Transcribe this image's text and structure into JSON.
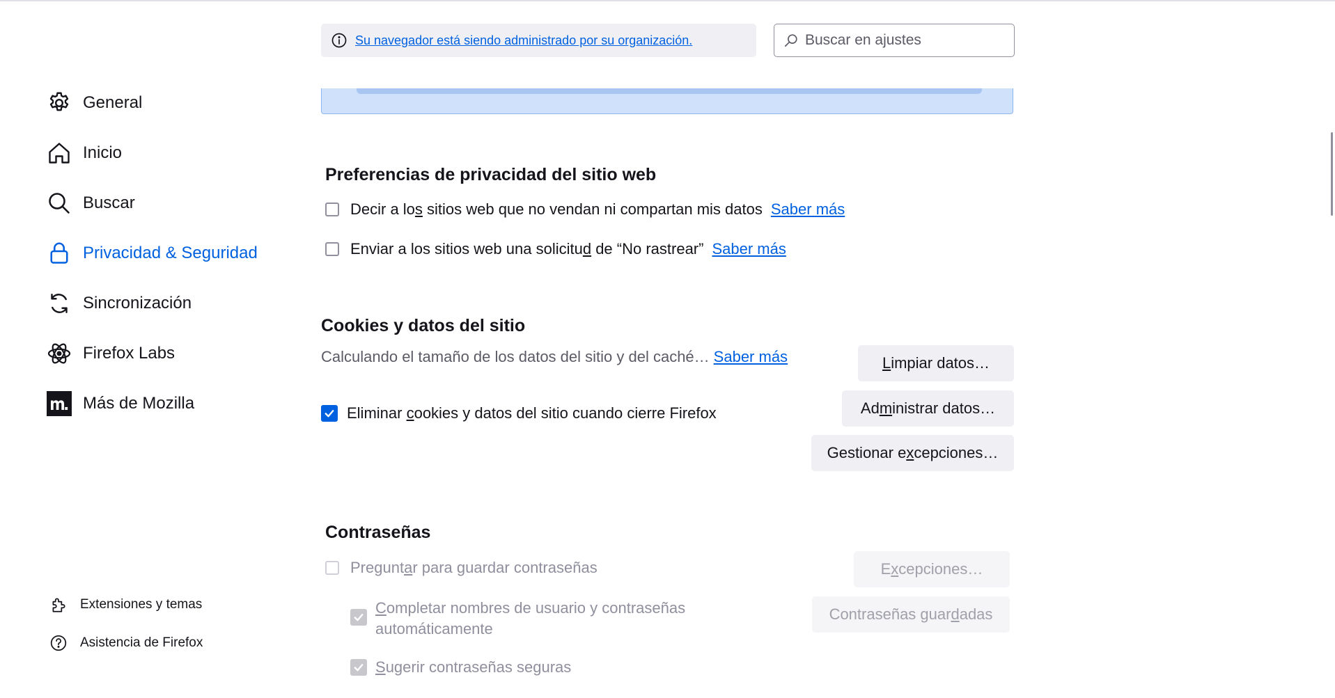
{
  "sidebar": {
    "items": [
      {
        "label": "General",
        "icon": "gear-icon"
      },
      {
        "label": "Inicio",
        "icon": "home-icon"
      },
      {
        "label": "Buscar",
        "icon": "search-icon"
      },
      {
        "label": "Privacidad & Seguridad",
        "icon": "lock-icon",
        "active": true
      },
      {
        "label": "Sincronización",
        "icon": "sync-icon"
      },
      {
        "label": "Firefox Labs",
        "icon": "atom-icon"
      },
      {
        "label": "Más de Mozilla",
        "icon": "mozilla-m-icon"
      }
    ],
    "footer": [
      {
        "label": "Extensiones y temas",
        "icon": "puzzle-icon"
      },
      {
        "label": "Asistencia de Firefox",
        "icon": "help-icon"
      }
    ]
  },
  "banner": {
    "text": "Su navegador está siendo administrado por su organización."
  },
  "search": {
    "placeholder": "Buscar en ajustes"
  },
  "privacy_prefs": {
    "title": "Preferencias de privacidad del sitio web",
    "option1": {
      "pre": "Decir a lo",
      "key": "s",
      "post": " sitios web que no vendan ni compartan mis datos",
      "checked": false
    },
    "option2": {
      "pre": "Enviar a los sitios web una solicitu",
      "key": "d",
      "post": " de “No rastrear”",
      "checked": false
    },
    "learn_more": "Saber más"
  },
  "cookies": {
    "title": "Cookies y datos del sitio",
    "status": "Calculando el tamaño de los datos del sitio y del caché…",
    "learn_more": "Saber más",
    "delete_option": {
      "pre": "Eliminar ",
      "key": "c",
      "post": "ookies y datos del sitio cuando cierre Firefox",
      "checked": true
    },
    "clear_button": {
      "key": "L",
      "post": "impiar datos…"
    },
    "manage_button": {
      "pre": "Ad",
      "key": "m",
      "post": "inistrar datos…"
    },
    "exceptions_button": {
      "pre": "Gestionar e",
      "key": "x",
      "post": "cepciones…"
    }
  },
  "passwords": {
    "title": "Contraseñas",
    "ask_save": {
      "pre": "Pregunt",
      "key": "a",
      "post": "r para guardar contraseñas",
      "checked": false
    },
    "autofill": {
      "key": "C",
      "post": "ompletar nombres de usuario y contraseñas",
      "line2": "automáticamente",
      "checked": true
    },
    "suggest": {
      "key": "S",
      "post": "ugerir contraseñas seguras",
      "checked": true
    },
    "exceptions_button": {
      "pre": "E",
      "key": "x",
      "post": "cepciones…"
    },
    "saved_button": {
      "pre": "Contraseñas guar",
      "key": "d",
      "post": "adas"
    }
  },
  "colors": {
    "accent": "#0061e0",
    "text": "#15141a",
    "muted": "#5b5b66",
    "button_bg": "#f0f0f4"
  }
}
